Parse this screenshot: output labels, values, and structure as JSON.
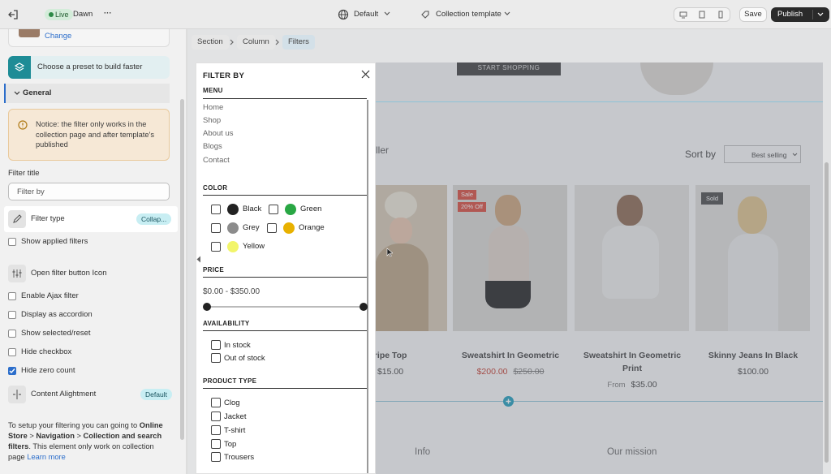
{
  "topbar": {
    "status": "Live",
    "theme": "Dawn",
    "more": "···",
    "center_select": "Default",
    "template_select": "Collection template",
    "save": "Save",
    "publish": "Publish"
  },
  "sidebar": {
    "change_link": "Change",
    "preset_label": "Choose a preset to build faster",
    "section_label": "General",
    "notice": "Notice: the filter only works in the collection page and after template's published",
    "filter_title_label": "Filter title",
    "filter_title_value": "Filter by",
    "filter_type_label": "Filter type",
    "filter_type_badge": "Collap...",
    "show_applied": "Show applied filters",
    "open_filter_icon": "Open filter button Icon",
    "enable_ajax": "Enable Ajax filter",
    "display_accordion": "Display as accordion",
    "show_selected": "Show selected/reset",
    "hide_checkbox": "Hide checkbox",
    "hide_zero": "Hide zero count",
    "content_alignment": "Content Alightment",
    "content_alignment_badge": "Default",
    "help_1": "To setup your filtering you can going to",
    "help_bold_1": "Online",
    "help_bold_2": "Store",
    "help_bold_3": "Navigation",
    "help_bold_4": "Collection and search filters",
    "help_sep": ">",
    "help_tail": ". This element only work on collection page",
    "learn_more": "Learn more"
  },
  "breadcrumb": {
    "items": [
      "Section",
      "Column",
      "Filters"
    ]
  },
  "storefront": {
    "start_shopping": "START SHOPPING",
    "heading_fragment": "ller",
    "sort_label": "Sort by",
    "sort_value": "Best selling",
    "products": [
      {
        "title": "d Stripe Top",
        "price": "$15.00",
        "badge": "",
        "badge2": ""
      },
      {
        "title": "Sweatshirt In Geometric",
        "price": "$200.00",
        "compare": "$250.00",
        "badge": "Sale",
        "badge2": "20% Off"
      },
      {
        "title_1": "Sweatshirt In Geometric",
        "title_2": "Print",
        "from": "From",
        "price": "$35.00"
      },
      {
        "title": "Skinny Jeans In Black",
        "price": "$100.00",
        "badge": "Sold"
      }
    ],
    "footer_info": "Info",
    "footer_mission": "Our mission"
  },
  "filter_panel": {
    "title": "FILTER BY",
    "menu_heading": "MENU",
    "menu_items": [
      "Home",
      "Shop",
      "About us",
      "Blogs",
      "Contact"
    ],
    "color_heading": "COLOR",
    "colors": [
      {
        "name": "Black",
        "hex": "#222222"
      },
      {
        "name": "Green",
        "hex": "#29a744"
      },
      {
        "name": "Grey",
        "hex": "#8c8c8c"
      },
      {
        "name": "Orange",
        "hex": "#e8b100"
      },
      {
        "name": "Yellow",
        "hex": "#f2f56a"
      }
    ],
    "price_heading": "PRICE",
    "price_range": "$0.00 - $350.00",
    "availability_heading": "AVAILABILITY",
    "availability": [
      "In stock",
      "Out of stock"
    ],
    "product_type_heading": "PRODUCT TYPE",
    "product_types": [
      "Clog",
      "Jacket",
      "T-shirt",
      "Top",
      "Trousers"
    ]
  }
}
